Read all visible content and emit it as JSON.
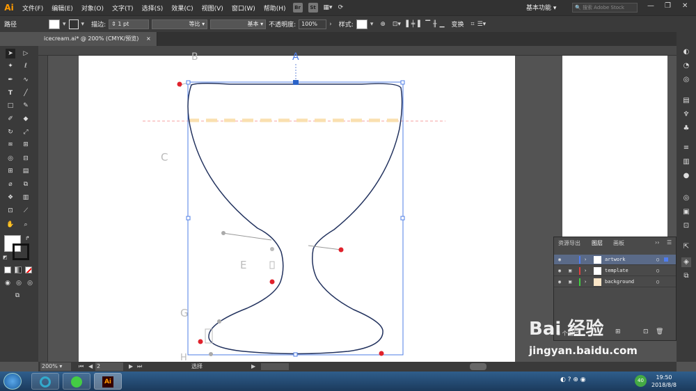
{
  "app": {
    "logo": "Ai"
  },
  "menu": [
    "文件(F)",
    "编辑(E)",
    "对象(O)",
    "文字(T)",
    "选择(S)",
    "效果(C)",
    "视图(V)",
    "窗口(W)",
    "帮助(H)"
  ],
  "bridge_btns": [
    "Br",
    "St"
  ],
  "workspace": "基本功能",
  "search_placeholder": "搜索 Adobe Stock",
  "control": {
    "selection_label": "路径",
    "stroke_label": "描边:",
    "stroke_weight": "1 pt",
    "profile_label": "等比",
    "brush_label": "基本",
    "opacity_label": "不透明度:",
    "opacity_value": "100%",
    "style_label": "样式:",
    "transform_label": "变换"
  },
  "document_tab": {
    "title": "icecream.ai* @ 200% (CMYK/预览)",
    "close": "×"
  },
  "canvas_labels": {
    "a": "A",
    "b": "B",
    "c": "C",
    "e": "E",
    "g": "G",
    "h": "H"
  },
  "layers_panel": {
    "tabs": [
      "资源导出",
      "图层",
      "画板"
    ],
    "layers": [
      {
        "name": "artwork",
        "color": "#4f7df0"
      },
      {
        "name": "template",
        "color": "#e04040"
      },
      {
        "name": "background",
        "color": "#40d040"
      }
    ],
    "footer": "3 个图层"
  },
  "status": {
    "zoom": "200%",
    "artboard_num": "2",
    "tool_label": "选择"
  },
  "taskbar": {
    "time": "19:50",
    "date": "2018/8/8",
    "badge": "40"
  },
  "watermark": {
    "logo": "Bai 经验",
    "url": "jingyan.baidu.com"
  }
}
